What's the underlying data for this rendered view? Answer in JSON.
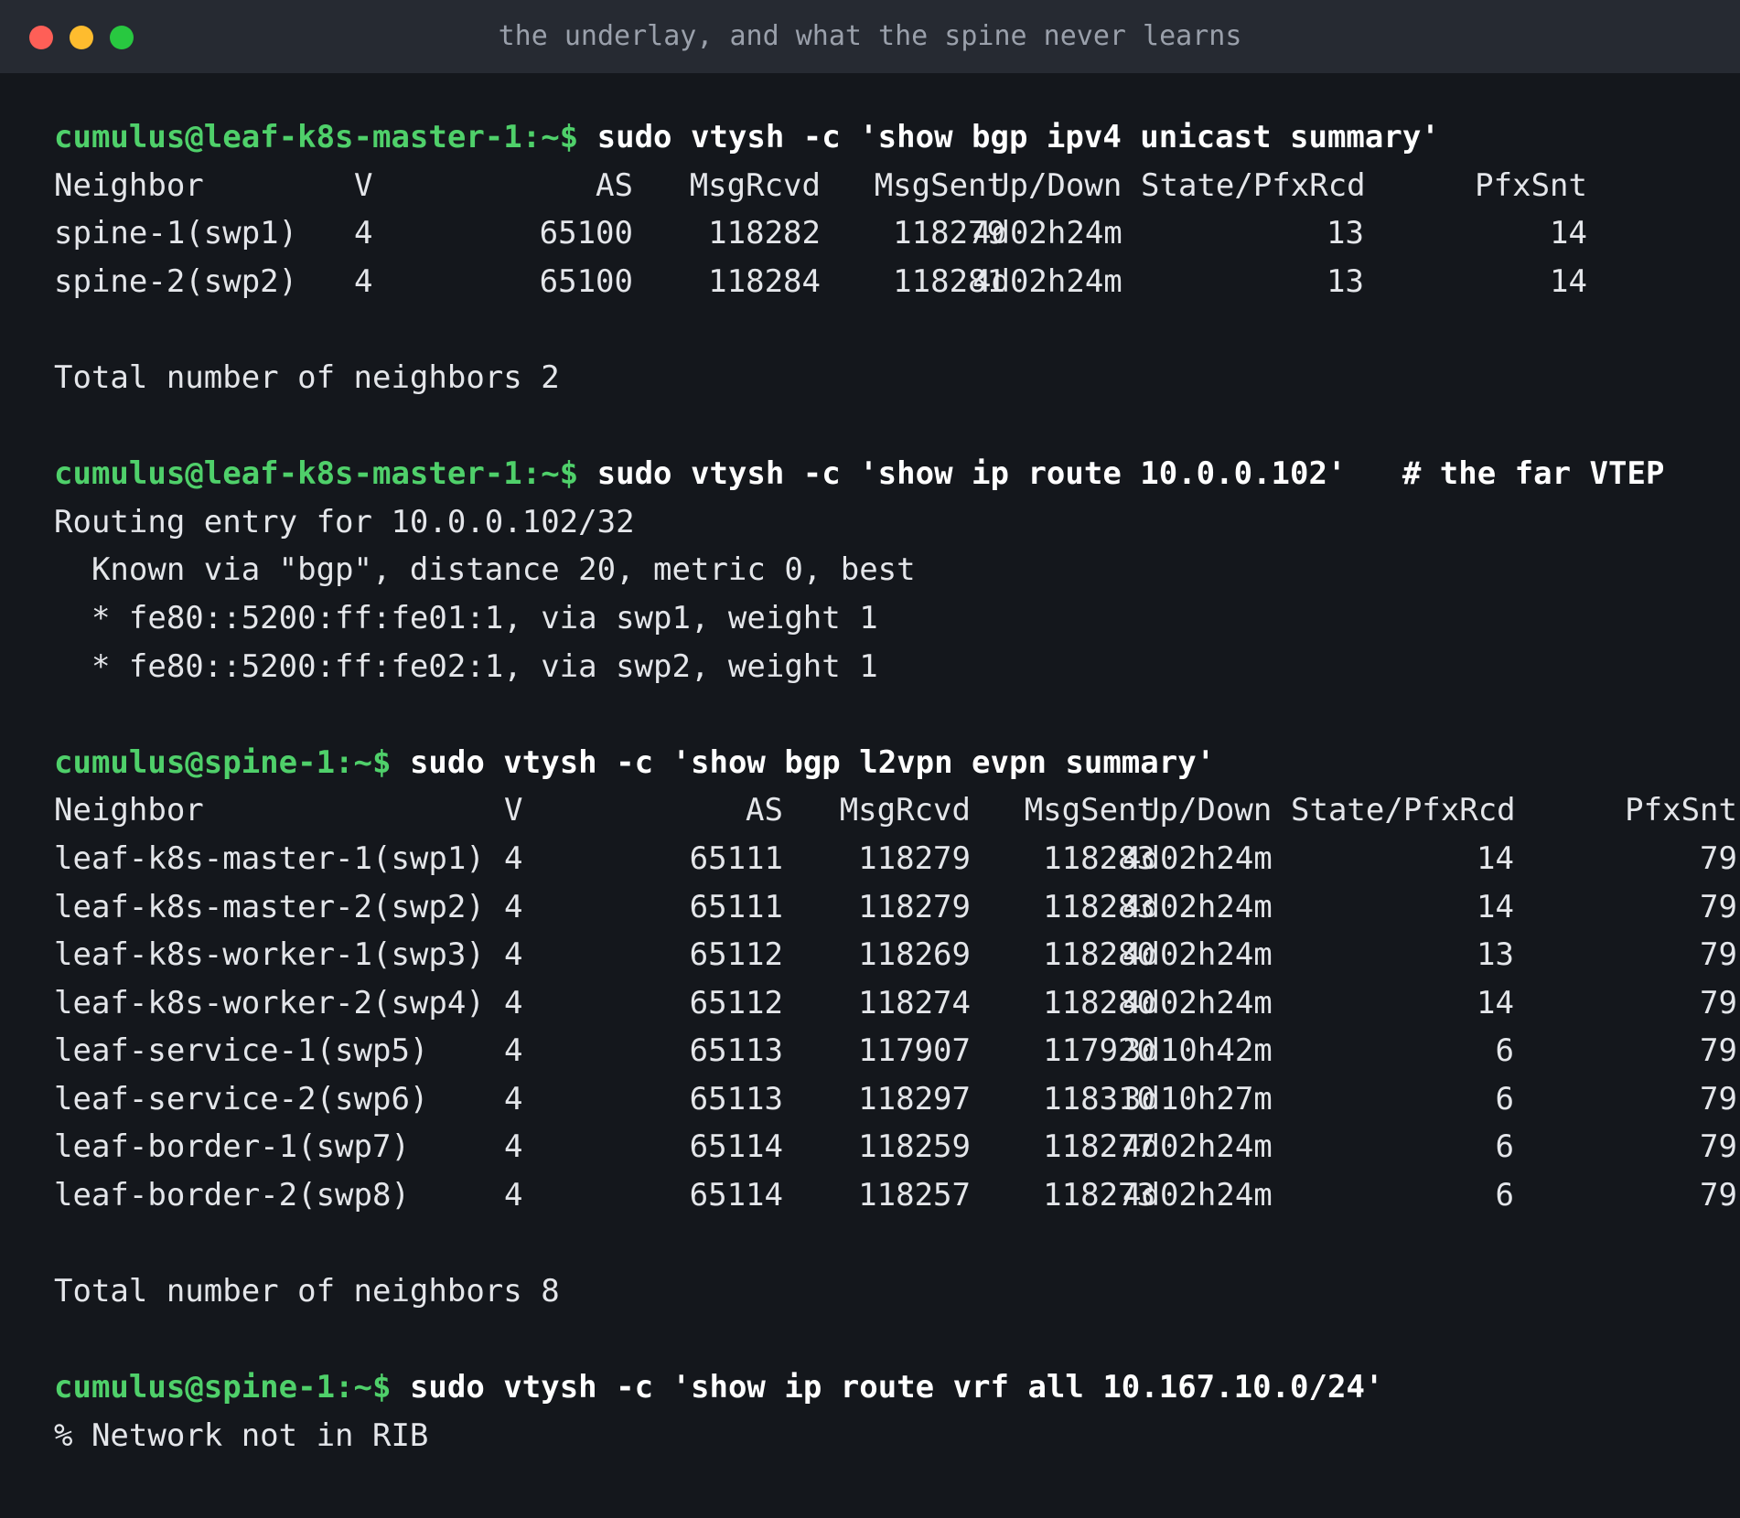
{
  "window": {
    "title": "the underlay, and what the spine never learns",
    "buttons": [
      "close",
      "minimize",
      "maximize"
    ]
  },
  "blocks": [
    {
      "prompt": "cumulus@leaf-k8s-master-1:~$",
      "command": "sudo vtysh -c 'show bgp ipv4 unicast summary'",
      "comment": "",
      "table": {
        "headers": [
          "Neighbor",
          "V",
          "AS",
          "MsgRcvd",
          "MsgSent",
          "Up/Down",
          "State/PfxRcd",
          "PfxSnt"
        ],
        "rows": [
          [
            "spine-1(swp1)",
            "4",
            "65100",
            "118282",
            "118279",
            "4d02h24m",
            "13",
            "14"
          ],
          [
            "spine-2(swp2)",
            "4",
            "65100",
            "118284",
            "118281",
            "4d02h24m",
            "13",
            "14"
          ]
        ]
      },
      "footer": "Total number of neighbors 2"
    },
    {
      "prompt": "cumulus@leaf-k8s-master-1:~$",
      "command": "sudo vtysh -c 'show ip route 10.0.0.102'",
      "comment": "# the far VTEP",
      "output": [
        "Routing entry for 10.0.0.102/32",
        "  Known via \"bgp\", distance 20, metric 0, best",
        "  * fe80::5200:ff:fe01:1, via swp1, weight 1",
        "  * fe80::5200:ff:fe02:1, via swp2, weight 1"
      ]
    },
    {
      "prompt": "cumulus@spine-1:~$",
      "command": "sudo vtysh -c 'show bgp l2vpn evpn summary'",
      "comment": "",
      "table": {
        "headers": [
          "Neighbor",
          "V",
          "AS",
          "MsgRcvd",
          "MsgSent",
          "Up/Down",
          "State/PfxRcd",
          "PfxSnt"
        ],
        "rows": [
          [
            "leaf-k8s-master-1(swp1)",
            "4",
            "65111",
            "118279",
            "118283",
            "4d02h24m",
            "14",
            "79"
          ],
          [
            "leaf-k8s-master-2(swp2)",
            "4",
            "65111",
            "118279",
            "118283",
            "4d02h24m",
            "14",
            "79"
          ],
          [
            "leaf-k8s-worker-1(swp3)",
            "4",
            "65112",
            "118269",
            "118280",
            "4d02h24m",
            "13",
            "79"
          ],
          [
            "leaf-k8s-worker-2(swp4)",
            "4",
            "65112",
            "118274",
            "118280",
            "4d02h24m",
            "14",
            "79"
          ],
          [
            "leaf-service-1(swp5)",
            "4",
            "65113",
            "117907",
            "117920",
            "3d10h42m",
            "6",
            "79"
          ],
          [
            "leaf-service-2(swp6)",
            "4",
            "65113",
            "118297",
            "118310",
            "3d10h27m",
            "6",
            "79"
          ],
          [
            "leaf-border-1(swp7)",
            "4",
            "65114",
            "118259",
            "118277",
            "4d02h24m",
            "6",
            "79"
          ],
          [
            "leaf-border-2(swp8)",
            "4",
            "65114",
            "118257",
            "118273",
            "4d02h24m",
            "6",
            "79"
          ]
        ]
      },
      "footer": "Total number of neighbors 8"
    },
    {
      "prompt": "cumulus@spine-1:~$",
      "command": "sudo vtysh -c 'show ip route vrf all 10.167.10.0/24'",
      "comment": "",
      "output": [
        "% Network not in RIB"
      ]
    }
  ]
}
